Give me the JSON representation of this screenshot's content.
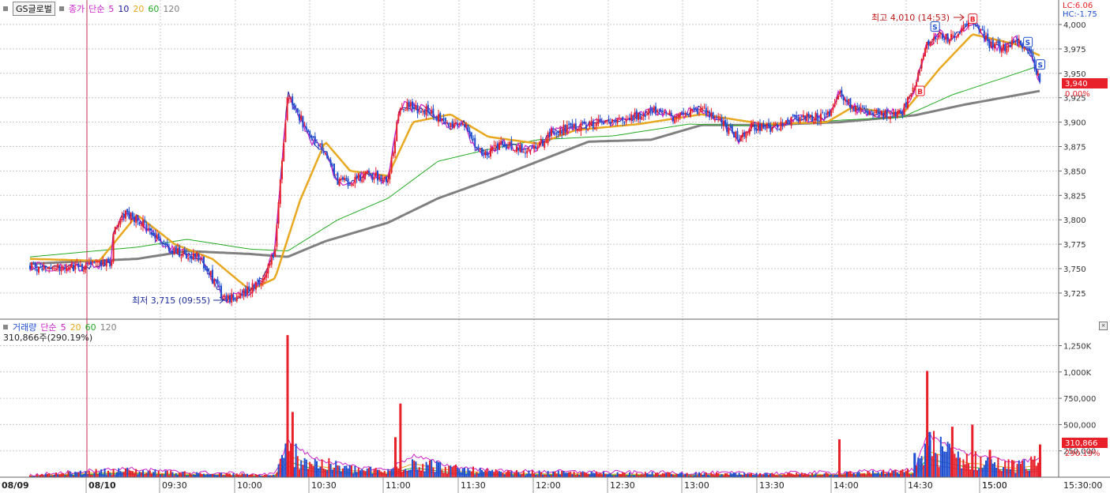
{
  "stock": {
    "name": "GS글로벌"
  },
  "price_panel": {
    "legend": {
      "type": "종가",
      "method": "단순",
      "periods": [
        "5",
        "10",
        "20",
        "60",
        "120"
      ]
    },
    "readout": {
      "lc": "LC:6.06",
      "hc": "HC:-1.75"
    },
    "current_price_label": "3,940",
    "current_change_label": "0.00%",
    "high_annotation": "최고 4,010 (14:53)",
    "low_annotation": "최저 3,715 (09:55)"
  },
  "volume_panel": {
    "legend": {
      "name": "거래량",
      "method": "단순",
      "periods": [
        "5",
        "20",
        "60",
        "120"
      ]
    },
    "info": "310,866주(290.19%)",
    "current_volume_label": "310,866",
    "current_ratio_label": "290.19%"
  },
  "colors": {
    "up": "#e8202a",
    "down": "#1f4fd0",
    "ma5": "#cc22cc",
    "ma10": "#1a1aa0",
    "ma20": "#e8a820",
    "ma60": "#22aa22",
    "ma120": "#808080",
    "grid": "#c8c8c8",
    "axis_text": "#333333"
  },
  "chart_data": [
    {
      "type": "candlestick",
      "title": "",
      "yaxis_ticks": [
        "4,000",
        "3,975",
        "3,950",
        "3,925",
        "3,900",
        "3,875",
        "3,850",
        "3,825",
        "3,800",
        "3,775",
        "3,750",
        "3,725"
      ],
      "ylim": [
        3704,
        4025
      ],
      "xaxis_ticks": [
        "08/09",
        "15:00",
        "08/10",
        "09:30",
        "10:00",
        "10:30",
        "11:00",
        "11:30",
        "12:00",
        "12:30",
        "13:00",
        "13:30",
        "14:00",
        "14:30",
        "15:00",
        "15:30:00"
      ],
      "x_range": [
        "08/09 14:58",
        "08/10 15:30"
      ],
      "moving_averages": [
        5,
        10,
        20,
        60,
        120
      ],
      "high": {
        "value": 4010,
        "time": "14:53"
      },
      "low": {
        "value": 3715,
        "time": "09:55"
      },
      "close_path": [
        {
          "t": "08/09 14:58",
          "v": 3752
        },
        {
          "t": "08/09 15:10",
          "v": 3752
        },
        {
          "t": "08/09 15:20",
          "v": 3757
        },
        {
          "t": "09:05",
          "v": 3770
        },
        {
          "t": "09:10",
          "v": 3783
        },
        {
          "t": "09:15",
          "v": 3808
        },
        {
          "t": "09:20",
          "v": 3800
        },
        {
          "t": "09:25",
          "v": 3790
        },
        {
          "t": "09:30",
          "v": 3775
        },
        {
          "t": "09:35",
          "v": 3768
        },
        {
          "t": "09:40",
          "v": 3765
        },
        {
          "t": "09:45",
          "v": 3762
        },
        {
          "t": "09:50",
          "v": 3740
        },
        {
          "t": "09:55",
          "v": 3718
        },
        {
          "t": "10:00",
          "v": 3722
        },
        {
          "t": "10:05",
          "v": 3728
        },
        {
          "t": "10:10",
          "v": 3740
        },
        {
          "t": "10:15",
          "v": 3770
        },
        {
          "t": "10:20",
          "v": 3930
        },
        {
          "t": "10:25",
          "v": 3905
        },
        {
          "t": "10:30",
          "v": 3880
        },
        {
          "t": "10:35",
          "v": 3870
        },
        {
          "t": "10:40",
          "v": 3840
        },
        {
          "t": "10:45",
          "v": 3838
        },
        {
          "t": "10:50",
          "v": 3846
        },
        {
          "t": "10:55",
          "v": 3845
        },
        {
          "t": "11:00",
          "v": 3840
        },
        {
          "t": "11:05",
          "v": 3918
        },
        {
          "t": "11:10",
          "v": 3915
        },
        {
          "t": "11:15",
          "v": 3912
        },
        {
          "t": "11:20",
          "v": 3905
        },
        {
          "t": "11:25",
          "v": 3895
        },
        {
          "t": "11:30",
          "v": 3900
        },
        {
          "t": "11:35",
          "v": 3872
        },
        {
          "t": "11:40",
          "v": 3868
        },
        {
          "t": "11:45",
          "v": 3878
        },
        {
          "t": "11:50",
          "v": 3875
        },
        {
          "t": "11:55",
          "v": 3872
        },
        {
          "t": "12:00",
          "v": 3875
        },
        {
          "t": "12:05",
          "v": 3890
        },
        {
          "t": "12:15",
          "v": 3895
        },
        {
          "t": "12:25",
          "v": 3900
        },
        {
          "t": "12:35",
          "v": 3902
        },
        {
          "t": "12:45",
          "v": 3912
        },
        {
          "t": "12:55",
          "v": 3905
        },
        {
          "t": "13:05",
          "v": 3915
        },
        {
          "t": "13:15",
          "v": 3895
        },
        {
          "t": "13:20",
          "v": 3882
        },
        {
          "t": "13:25",
          "v": 3895
        },
        {
          "t": "13:35",
          "v": 3895
        },
        {
          "t": "13:45",
          "v": 3905
        },
        {
          "t": "13:55",
          "v": 3905
        },
        {
          "t": "14:00",
          "v": 3930
        },
        {
          "t": "14:05",
          "v": 3915
        },
        {
          "t": "14:15",
          "v": 3908
        },
        {
          "t": "14:25",
          "v": 3910
        },
        {
          "t": "14:30",
          "v": 3935
        },
        {
          "t": "14:35",
          "v": 3980
        },
        {
          "t": "14:40",
          "v": 3990
        },
        {
          "t": "14:45",
          "v": 3985
        },
        {
          "t": "14:53",
          "v": 4005
        },
        {
          "t": "15:00",
          "v": 3980
        },
        {
          "t": "15:05",
          "v": 3975
        },
        {
          "t": "15:10",
          "v": 3985
        },
        {
          "t": "15:15",
          "v": 3975
        },
        {
          "t": "15:18",
          "v": 3958
        },
        {
          "t": "15:20",
          "v": 3940
        }
      ],
      "ma20_path": [
        {
          "t": "08/09 14:58",
          "v": 3760
        },
        {
          "t": "09:05",
          "v": 3758
        },
        {
          "t": "09:20",
          "v": 3805
        },
        {
          "t": "09:35",
          "v": 3775
        },
        {
          "t": "09:50",
          "v": 3760
        },
        {
          "t": "10:05",
          "v": 3728
        },
        {
          "t": "10:15",
          "v": 3740
        },
        {
          "t": "10:25",
          "v": 3820
        },
        {
          "t": "10:35",
          "v": 3880
        },
        {
          "t": "10:45",
          "v": 3850
        },
        {
          "t": "11:00",
          "v": 3845
        },
        {
          "t": "11:10",
          "v": 3900
        },
        {
          "t": "11:25",
          "v": 3908
        },
        {
          "t": "11:40",
          "v": 3885
        },
        {
          "t": "12:00",
          "v": 3878
        },
        {
          "t": "12:15",
          "v": 3892
        },
        {
          "t": "12:40",
          "v": 3898
        },
        {
          "t": "13:05",
          "v": 3908
        },
        {
          "t": "13:30",
          "v": 3898
        },
        {
          "t": "13:55",
          "v": 3900
        },
        {
          "t": "14:05",
          "v": 3915
        },
        {
          "t": "14:25",
          "v": 3908
        },
        {
          "t": "14:40",
          "v": 3955
        },
        {
          "t": "14:53",
          "v": 3990
        },
        {
          "t": "15:10",
          "v": 3980
        },
        {
          "t": "15:20",
          "v": 3968
        }
      ],
      "ma60_path": [
        {
          "t": "08/09 14:58",
          "v": 3762
        },
        {
          "t": "09:20",
          "v": 3772
        },
        {
          "t": "09:40",
          "v": 3780
        },
        {
          "t": "10:05",
          "v": 3770
        },
        {
          "t": "10:20",
          "v": 3768
        },
        {
          "t": "10:40",
          "v": 3800
        },
        {
          "t": "11:00",
          "v": 3822
        },
        {
          "t": "11:20",
          "v": 3860
        },
        {
          "t": "11:40",
          "v": 3872
        },
        {
          "t": "12:00",
          "v": 3882
        },
        {
          "t": "12:30",
          "v": 3886
        },
        {
          "t": "13:00",
          "v": 3898
        },
        {
          "t": "13:30",
          "v": 3896
        },
        {
          "t": "14:00",
          "v": 3902
        },
        {
          "t": "14:25",
          "v": 3905
        },
        {
          "t": "14:45",
          "v": 3928
        },
        {
          "t": "15:05",
          "v": 3945
        },
        {
          "t": "15:20",
          "v": 3958
        }
      ],
      "ma120_path": [
        {
          "t": "08/09 14:58",
          "v": 3755
        },
        {
          "t": "09:20",
          "v": 3760
        },
        {
          "t": "09:40",
          "v": 3768
        },
        {
          "t": "10:05",
          "v": 3765
        },
        {
          "t": "10:20",
          "v": 3762
        },
        {
          "t": "10:35",
          "v": 3778
        },
        {
          "t": "11:00",
          "v": 3797
        },
        {
          "t": "11:20",
          "v": 3822
        },
        {
          "t": "11:45",
          "v": 3845
        },
        {
          "t": "12:10",
          "v": 3870
        },
        {
          "t": "12:20",
          "v": 3880
        },
        {
          "t": "12:45",
          "v": 3882
        },
        {
          "t": "13:05",
          "v": 3897
        },
        {
          "t": "13:30",
          "v": 3897
        },
        {
          "t": "14:00",
          "v": 3900
        },
        {
          "t": "14:30",
          "v": 3907
        },
        {
          "t": "14:50",
          "v": 3918
        },
        {
          "t": "15:20",
          "v": 3932
        }
      ],
      "signals": [
        {
          "label": "B",
          "t": "14:32",
          "v": 3932
        },
        {
          "label": "S",
          "t": "14:38",
          "v": 3998
        },
        {
          "label": "B",
          "t": "14:53",
          "v": 4006
        },
        {
          "label": "S",
          "t": "15:15",
          "v": 3982
        },
        {
          "label": "S",
          "t": "15:20",
          "v": 3959
        }
      ]
    },
    {
      "type": "bar",
      "title": "",
      "yaxis_ticks": [
        "1,250K",
        "1,000K",
        "750,000",
        "500,000",
        "250,000"
      ],
      "ylim": [
        0,
        1450000
      ],
      "moving_averages": [
        5,
        20,
        60,
        120
      ],
      "spikes": [
        {
          "t": "10:20",
          "v": 1350000,
          "dir": "up"
        },
        {
          "t": "10:22",
          "v": 620000,
          "dir": "up"
        },
        {
          "t": "11:05",
          "v": 700000,
          "dir": "up"
        },
        {
          "t": "11:03",
          "v": 380000,
          "dir": "up"
        },
        {
          "t": "14:00",
          "v": 360000,
          "dir": "up"
        },
        {
          "t": "14:30",
          "v": 230000,
          "dir": "down"
        },
        {
          "t": "14:35",
          "v": 1010000,
          "dir": "up"
        },
        {
          "t": "14:36",
          "v": 430000,
          "dir": "down"
        },
        {
          "t": "14:45",
          "v": 480000,
          "dir": "up"
        },
        {
          "t": "14:53",
          "v": 500000,
          "dir": "up"
        },
        {
          "t": "15:00",
          "v": 260000,
          "dir": "up"
        },
        {
          "t": "15:20",
          "v": 310866,
          "dir": "up"
        }
      ],
      "level_path": [
        {
          "t": "08/09 14:58",
          "v": 15000
        },
        {
          "t": "09:05",
          "v": 60000
        },
        {
          "t": "09:15",
          "v": 70000
        },
        {
          "t": "09:40",
          "v": 40000
        },
        {
          "t": "10:15",
          "v": 20000
        },
        {
          "t": "10:20",
          "v": 300000
        },
        {
          "t": "10:30",
          "v": 160000
        },
        {
          "t": "10:45",
          "v": 90000
        },
        {
          "t": "11:00",
          "v": 60000
        },
        {
          "t": "11:10",
          "v": 180000
        },
        {
          "t": "11:25",
          "v": 90000
        },
        {
          "t": "11:45",
          "v": 50000
        },
        {
          "t": "12:30",
          "v": 40000
        },
        {
          "t": "13:30",
          "v": 30000
        },
        {
          "t": "14:00",
          "v": 40000
        },
        {
          "t": "14:30",
          "v": 60000
        },
        {
          "t": "14:35",
          "v": 350000
        },
        {
          "t": "14:50",
          "v": 200000
        },
        {
          "t": "15:10",
          "v": 120000
        },
        {
          "t": "15:20",
          "v": 160000
        }
      ]
    }
  ]
}
